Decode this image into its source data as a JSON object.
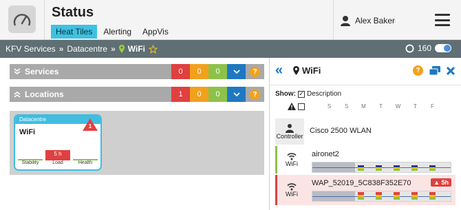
{
  "header": {
    "title": "Status",
    "tabs": [
      {
        "label": "Heat Tiles",
        "active": true
      },
      {
        "label": "Alerting",
        "active": false
      },
      {
        "label": "AppVis",
        "active": false
      }
    ],
    "user_name": "Alex Baker"
  },
  "breadcrumb": {
    "items": [
      "KFV Services",
      "Datacentre"
    ],
    "separator": "»",
    "current": "WiFi",
    "refresh_value": "160"
  },
  "sections": [
    {
      "title": "Services",
      "counts": {
        "red": "0",
        "orange": "0",
        "green": "0"
      }
    },
    {
      "title": "Locations",
      "counts": {
        "red": "1",
        "orange": "0",
        "green": "0"
      }
    }
  ],
  "tile": {
    "header": "Datacentre",
    "name": "WiFi",
    "alert_count": "1",
    "metrics": [
      {
        "label": "Stability",
        "value": ""
      },
      {
        "label": "Load",
        "value": "5 h"
      },
      {
        "label": "Health",
        "value": ""
      }
    ]
  },
  "panel": {
    "title": "WiFi",
    "show_label": "Show:",
    "description_label": "Description",
    "days": [
      "S",
      "S",
      "M",
      "T",
      "W",
      "T",
      "F"
    ],
    "devices": [
      {
        "type_label": "Controller",
        "name": "Cisco 2500 WLAN",
        "badge": ""
      },
      {
        "type_label": "WiFi",
        "name": "aironet2",
        "badge": ""
      },
      {
        "type_label": "WiFi",
        "name": "WAP_52019_5C838F352E70",
        "badge": "5h"
      }
    ]
  },
  "colors": {
    "accent": "#3fc1e0",
    "breadcrumb_bg": "#5f6f74",
    "red": "#e04040",
    "orange": "#f1a11d",
    "green": "#8cc24a",
    "blue": "#1f78c1",
    "section_bg": "#a9a9a9"
  }
}
